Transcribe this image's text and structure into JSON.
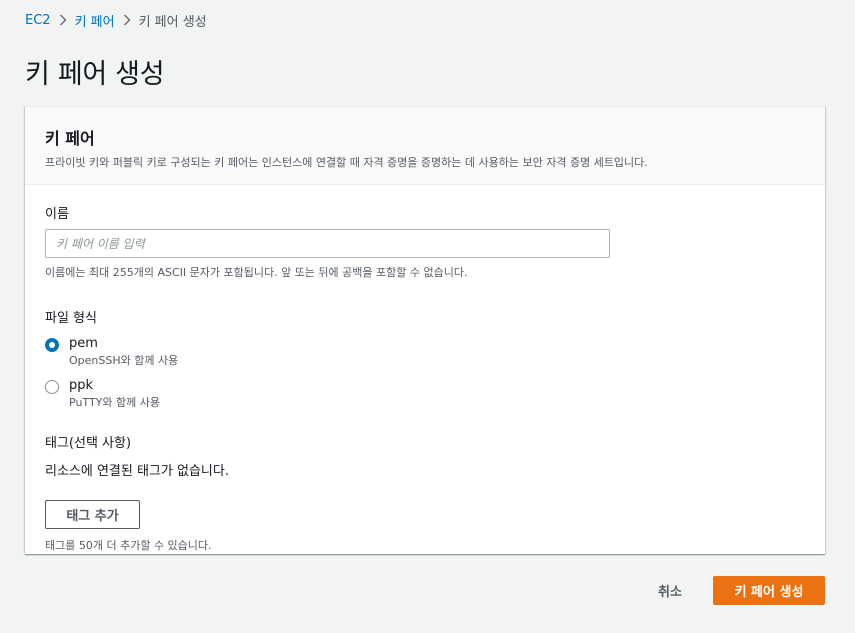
{
  "breadcrumb": {
    "items": [
      {
        "label": "EC2",
        "link": true
      },
      {
        "label": "키 페어",
        "link": true
      },
      {
        "label": "키 페어 생성",
        "link": false
      }
    ],
    "separator_icon": "chevron-right-icon"
  },
  "page": {
    "title": "키 페어 생성"
  },
  "panel": {
    "title": "키 페어",
    "description": "프라이빗 키와 퍼블릭 키로 구성되는 키 페어는 인스턴스에 연결할 때 자격 증명을 증명하는 데 사용하는 보안 자격 증명 세트입니다."
  },
  "name_field": {
    "label": "이름",
    "placeholder": "키 페어 이름 입력",
    "value": "",
    "hint": "이름에는 최대 255개의 ASCII 문자가 포함됩니다. 앞 또는 뒤에 공백을 포함할 수 없습니다."
  },
  "file_format": {
    "label": "파일 형식",
    "options": [
      {
        "title": "pem",
        "description": "OpenSSH와 함께 사용",
        "selected": true
      },
      {
        "title": "ppk",
        "description": "PuTTY와 함께 사용",
        "selected": false
      }
    ]
  },
  "tags": {
    "label": "태그(선택 사항)",
    "empty_text": "리소스에 연결된 태그가 없습니다.",
    "add_button": "태그 추가",
    "hint": "태그를 50개 더 추가할 수 있습니다."
  },
  "actions": {
    "cancel": "취소",
    "create": "키 페어 생성"
  },
  "colors": {
    "link": "#0073bb",
    "primary_button": "#ec7211",
    "page_background": "#f2f3f3"
  }
}
